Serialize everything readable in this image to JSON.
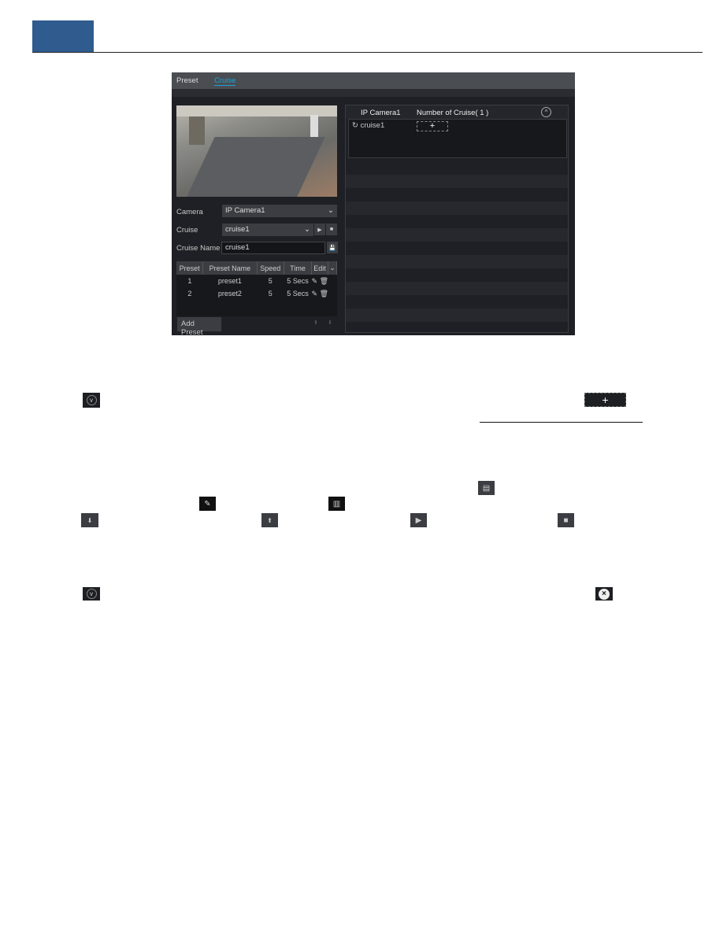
{
  "tabs": [
    {
      "label": "Preset",
      "active": false
    },
    {
      "label": "Cruise",
      "active": true
    }
  ],
  "accent_color": "#1fa3d6",
  "form": {
    "camera_label": "Camera",
    "camera_value": "IP Camera1",
    "cruise_label": "Cruise",
    "cruise_value": "cruise1",
    "cruise_name_label": "Cruise Name",
    "cruise_name_value": "cruise1"
  },
  "table": {
    "headers": [
      "Preset",
      "Preset Name",
      "Speed",
      "Time",
      "Edit"
    ],
    "rows": [
      {
        "preset": "1",
        "name": "preset1",
        "speed": "5",
        "time": "5 Secs"
      },
      {
        "preset": "2",
        "name": "preset2",
        "speed": "5",
        "time": "5 Secs"
      }
    ]
  },
  "add_preset_label": "Add Preset",
  "right_panel": {
    "camera": "IP Camera1",
    "count_label": "Number of Cruise( 1 )",
    "cruise_item": "cruise1"
  },
  "doc_icons": [
    "chevron-down-icon",
    "add-cruise-icon",
    "save-icon",
    "edit-icon",
    "delete-icon",
    "move-down-icon",
    "move-up-icon",
    "play-icon",
    "stop-icon",
    "chevron-down-icon",
    "close-icon"
  ]
}
